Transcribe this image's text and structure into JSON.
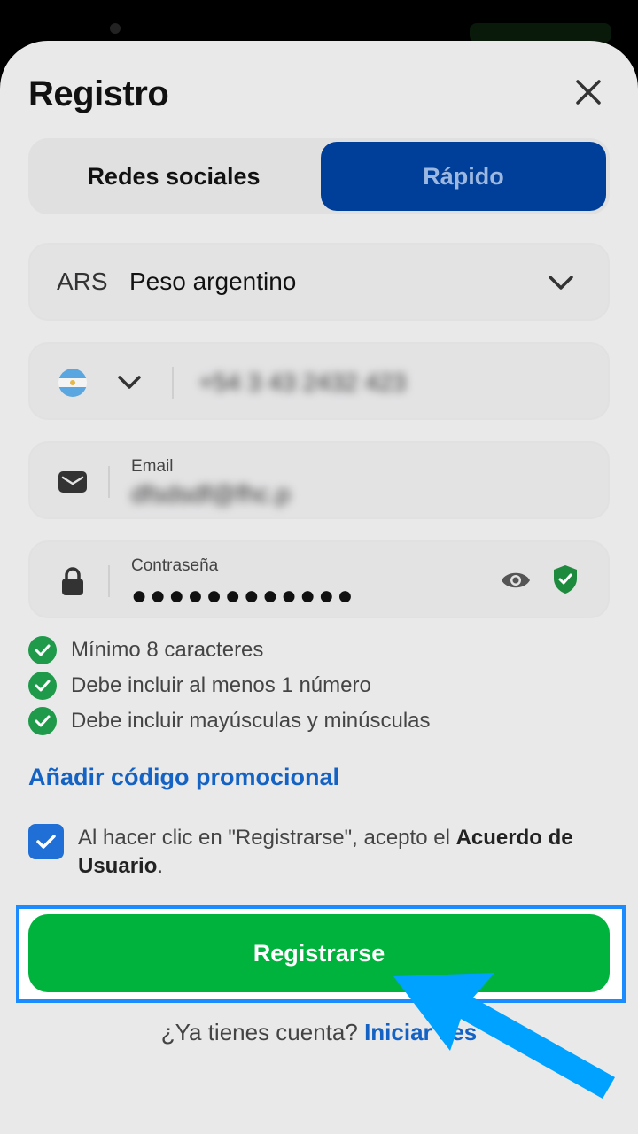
{
  "dialog": {
    "title": "Registro"
  },
  "tabs": {
    "social_label": "Redes sociales",
    "quick_label": "Rápido",
    "active": "quick"
  },
  "currency": {
    "code": "ARS",
    "name": "Peso argentino"
  },
  "phone": {
    "country_flag": "argentina-flag-icon",
    "value": "+54 3 43 2432 423"
  },
  "email": {
    "label": "Email",
    "value": "dfsdsdf@fhc.p"
  },
  "password": {
    "label": "Contraseña",
    "value": "●●●●●●●●●●●●"
  },
  "password_rules": [
    {
      "text": "Mínimo 8 caracteres"
    },
    {
      "text": "Debe incluir al menos 1 número"
    },
    {
      "text": "Debe incluir mayúsculas y minúsculas"
    }
  ],
  "promo_link": "Añadir código promocional",
  "agreement": {
    "text_before": "Al hacer clic en \"Registrarse\", acepto el ",
    "bold": "Acuerdo de Usuario",
    "text_after": "."
  },
  "register_button": "Registrarse",
  "login_prompt": {
    "text": "¿Ya tienes cuenta?",
    "link": "Iniciar ses"
  },
  "colors": {
    "primary_blue": "#003f99",
    "link_blue": "#1463c4",
    "success_green": "#00b33c",
    "highlight_blue": "#1a8cff",
    "arrow_blue": "#00a2ff"
  }
}
